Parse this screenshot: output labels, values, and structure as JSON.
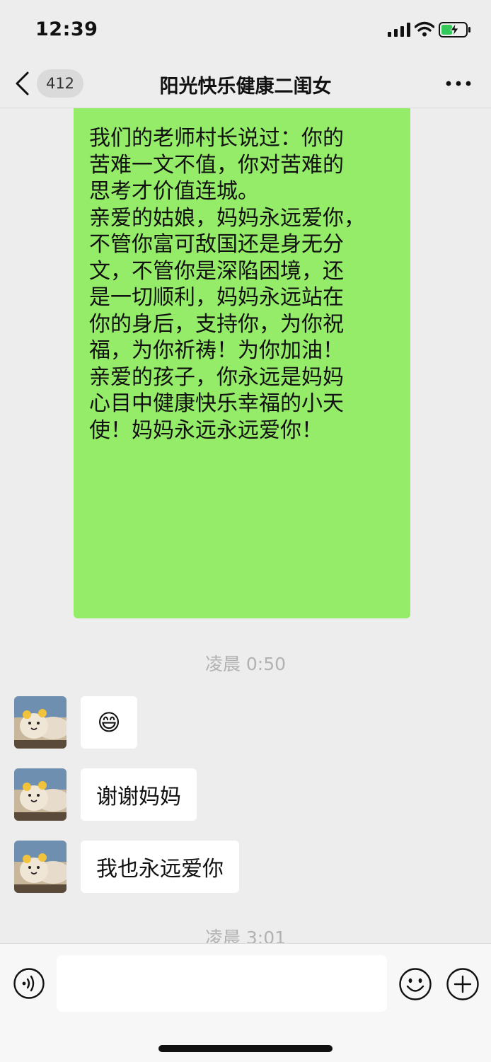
{
  "status_bar": {
    "time": "12:39",
    "icons": [
      "cellular-signal-icon",
      "wifi-icon",
      "battery-charging-icon"
    ]
  },
  "nav": {
    "back_icon": "chevron-left-icon",
    "unread_count": "412",
    "title": "阳光快乐健康二闺女",
    "more_icon": "more-dots-icon"
  },
  "messages": {
    "sent": {
      "text": "我们的老师村长说过：你的\n苦难一文不值，你对苦难的\n思考才价值连城。\n亲爱的姑娘，妈妈永远爱你，\n不管你富可敌国还是身无分\n文，不管你是深陷困境，还\n是一切顺利，妈妈永远站在\n你的身后，支持你，为你祝\n福，为你祈祷！为你加油！\n亲爱的孩子，你永远是妈妈\n心目中健康快乐幸福的小天\n使！妈妈永远永远爱你！",
      "bubble_color": "#95ec69"
    },
    "timestamp_1": "凌晨 0:50",
    "received": [
      {
        "text": "😄",
        "kind": "emoji"
      },
      {
        "text": "谢谢妈妈",
        "kind": "text"
      },
      {
        "text": "我也永远爱你",
        "kind": "text"
      }
    ],
    "timestamp_2": "凌晨 3:01"
  },
  "input_bar": {
    "voice_icon": "voice-input-icon",
    "input_value": "",
    "emoji_icon": "smiley-icon",
    "plus_icon": "plus-icon"
  },
  "colors": {
    "background": "#ededed",
    "sent_bubble": "#95ec69",
    "received_bubble": "#ffffff",
    "battery_charging": "#34c759"
  }
}
